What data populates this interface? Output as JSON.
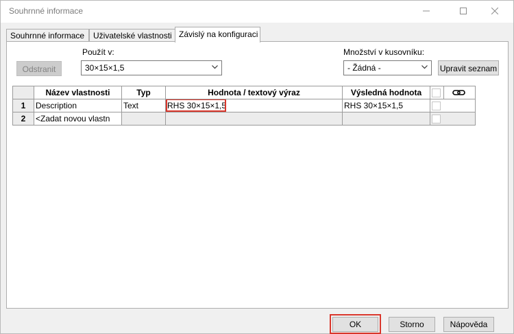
{
  "window": {
    "title": "Souhrnné informace"
  },
  "tabs": [
    {
      "label": "Souhrnné informace",
      "active": false
    },
    {
      "label": "Uživatelské vlastnosti",
      "active": false
    },
    {
      "label": "Závislý na konfiguraci",
      "active": true
    }
  ],
  "toolbar": {
    "remove_label": "Odstranit",
    "apply_in_label": "Použít v:",
    "apply_in_value": "30×15×1,5",
    "bom_qty_label": "Množství v kusovníku:",
    "bom_qty_value": "- Žádná -",
    "edit_list_label": "Upravit seznam"
  },
  "table": {
    "headers": [
      "Název vlastnosti",
      "Typ",
      "Hodnota / textový výraz",
      "Výsledná hodnota"
    ],
    "rows": [
      {
        "num": "1",
        "name": "Description",
        "type": "Text",
        "value": "RHS 30×15×1,5",
        "result": "RHS 30×15×1,5"
      },
      {
        "num": "2",
        "name": "<Zadat novou vlastn",
        "type": "",
        "value": "",
        "result": ""
      }
    ]
  },
  "footer": {
    "ok": "OK",
    "cancel": "Storno",
    "help": "Nápověda"
  },
  "colors": {
    "highlight": "#d9362b"
  }
}
